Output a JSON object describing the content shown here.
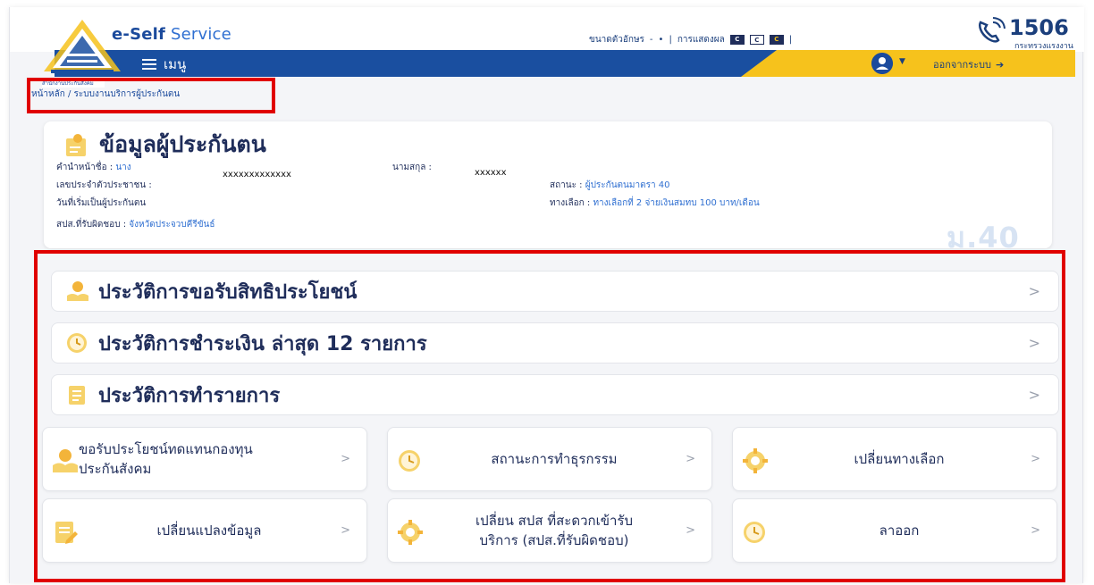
{
  "header": {
    "brand_bold": "e-Self",
    "brand_light": " Service",
    "logo_caption": "สำนักงานประกันสังคม",
    "font_size_label": "ขนาดตัวอักษร",
    "font_minus": "-",
    "font_dot": "•",
    "display_label": "การแสดงผล",
    "swatch_label": "C",
    "separator": "|",
    "hotline_number": "1506",
    "hotline_sub": "กระทรวงแรงงาน",
    "menu_label": "เมนู",
    "logout_label": "ออกจากระบบ"
  },
  "breadcrumb": "หน้าหลัก / ระบบงานบริการผู้ประกันตน",
  "info": {
    "title": "ข้อมูลผู้ประกันตน",
    "prefix_label": "คำนำหน้าชื่อ :",
    "prefix_value": "นาง",
    "surname_label": "นามสกุล :",
    "id_label": "เลขประจำตัวประชาชน :",
    "id_value": "xxxxxxxxxxxxx",
    "surname_value": "xxxxxx",
    "status_label": "สถานะ :",
    "status_value": "ผู้ประกันตนมาตรา 40",
    "start_label": "วันที่เริ่มเป็นผู้ประกันตน",
    "option_label": "ทางเลือก :",
    "option_value": "ทางเลือกที่ 2 จ่ายเงินสมทบ 100 บาท/เดือน",
    "office_label": "สปส.ที่รับผิดชอบ :",
    "office_value": "จังหวัดประจวบคีรีขันธ์",
    "badge": "ม.40"
  },
  "accordions": [
    {
      "label": "ประวัติการขอรับสิทธิประโยชน์"
    },
    {
      "label": "ประวัติการชำระเงิน ล่าสุด 12 รายการ"
    },
    {
      "label": "ประวัติการทำรายการ"
    }
  ],
  "tiles": [
    {
      "line1": "ขอรับประโยชน์ทดแทนกองทุน",
      "line2": "ประกันสังคม"
    },
    {
      "line1": "สถานะการทำธุรกรรม",
      "line2": ""
    },
    {
      "line1": "เปลี่ยนทางเลือก",
      "line2": ""
    },
    {
      "line1": "เปลี่ยนแปลงข้อมูล",
      "line2": ""
    },
    {
      "line1": "เปลี่ยน สปส ที่สะดวกเข้ารับ",
      "line2": "บริการ (สปส.ที่รับผิดชอบ)"
    },
    {
      "line1": "ลาออก",
      "line2": ""
    }
  ],
  "chevron": ">",
  "colors": {
    "primary_blue": "#1a4fa0",
    "accent_yellow": "#f6c21c",
    "highlight_red": "#e00000",
    "text_navy": "#1f2d5a"
  },
  "icons": {
    "logo": "sso-triangle-logo",
    "hotline": "phone-hotline-icon",
    "menu": "hamburger-icon",
    "user": "user-icon",
    "logout": "logout-icon",
    "info": "insured-person-icon",
    "benefit": "money-hands-icon",
    "payment": "clock-coin-icon",
    "transaction": "document-icon"
  }
}
